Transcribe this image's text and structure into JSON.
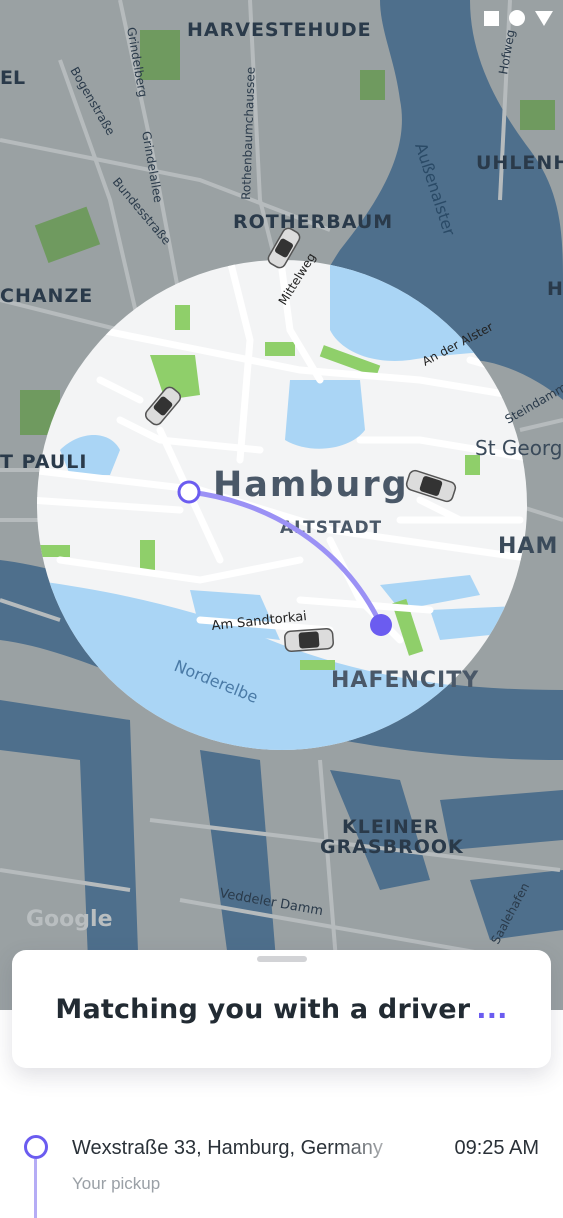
{
  "map": {
    "labels": {
      "harvestehude": "HARVESTEHUDE",
      "el": "EL",
      "uhlenh": "UHLENH",
      "h_right": "H",
      "rotherbaum": "ROTHERBAUM",
      "schanze": "CHANZE",
      "st_pauli": "T PAULI",
      "st_georg": "St Georg",
      "ham_right": "HAM",
      "hamburg": "Hamburg",
      "altstadt": "ALTSTADT",
      "hafencity": "HAFENCITY",
      "kleiner": "KLEINER",
      "grasbrook": "GRASBROOK",
      "aussenalster": "Außenalster",
      "mittelweg": "Mittelweg",
      "an_der_alster": "An der Alster",
      "steindamm": "Steindamm",
      "am_sandtorkai": "Am Sandtorkai",
      "norderelbe": "Norderelbe",
      "veddeler_damm": "Veddeler Damm",
      "saalehafen": "Saalehafen",
      "bogenstrasse": "Bogenstraße",
      "grindelberg": "Grindelberg",
      "grindelallee": "Grindelallee",
      "bundesstrasse": "Bundesstraße",
      "rothenbaumchaussee": "Rothenbaumchaussee",
      "hofweg": "Hofweg",
      "google": "Google"
    },
    "colors": {
      "land_dim": "#9aa1a3",
      "water_dim": "#4e6f8c",
      "land": "#f3f4f5",
      "water": "#aad5f5",
      "park": "#8fcf6a",
      "route": "#6b5cf0"
    }
  },
  "status_bar": {
    "icons": [
      "square-icon",
      "circle-icon",
      "triangle-icon"
    ]
  },
  "match_card": {
    "title": "Matching you with a driver",
    "dots": "..."
  },
  "pickup": {
    "address": "Wexstraße 33, Hamburg, Germany",
    "time": "09:25 AM",
    "label": "Your pickup"
  }
}
